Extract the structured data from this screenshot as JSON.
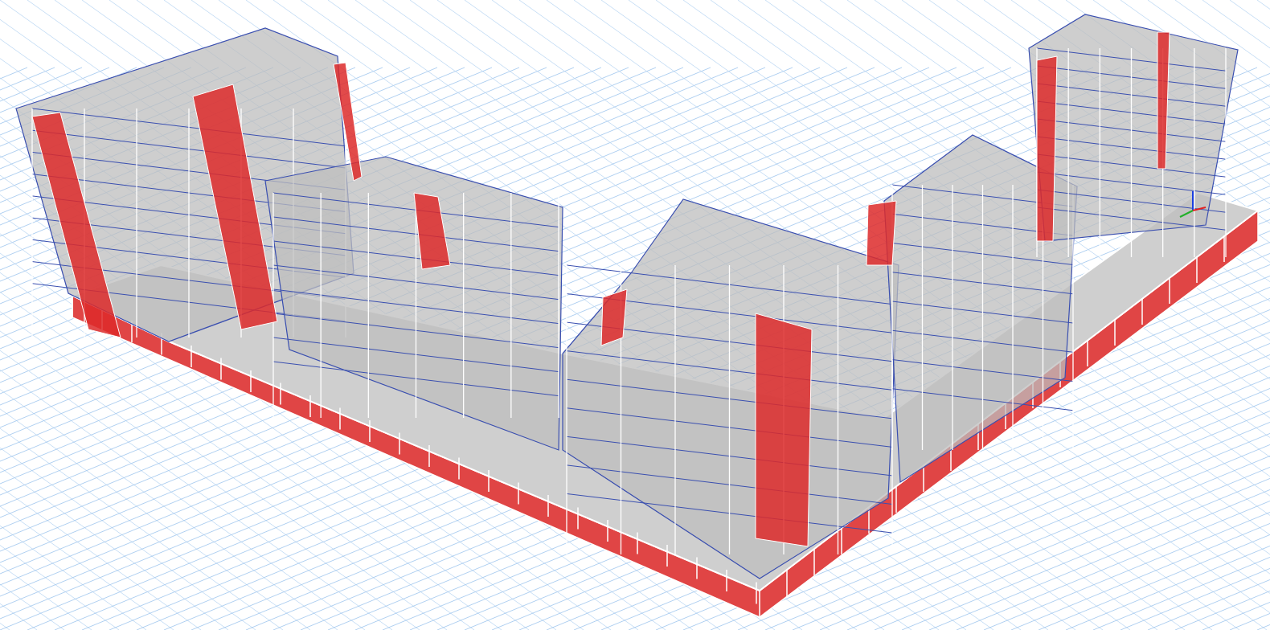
{
  "viewport": {
    "grid_visible": true,
    "axis_triad_visible": true
  }
}
